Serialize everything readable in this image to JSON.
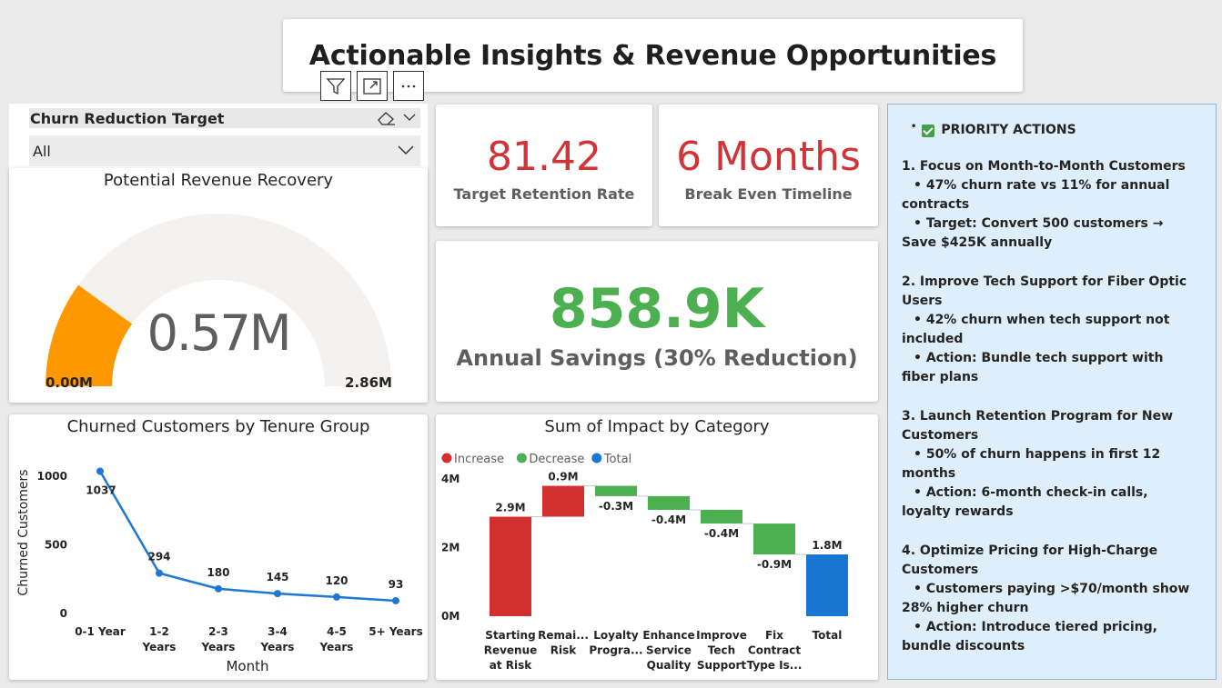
{
  "page": {
    "title": "Actionable Insights & Revenue Opportunities"
  },
  "visual_header": {
    "icons": [
      "filter-icon",
      "focus-mode-icon",
      "more-options-icon"
    ]
  },
  "slicer": {
    "title": "Churn Reduction Target",
    "value": "All"
  },
  "gauge": {
    "title": "Potential Revenue Recovery",
    "value_label": "0.57M",
    "min_label": "0.00M",
    "max_label": "2.86M",
    "value": 0.57,
    "min": 0,
    "max": 2.86,
    "fill_color": "#ff9800",
    "track_color": "#f3f2f1"
  },
  "kpis": {
    "retention": {
      "value": "81.42",
      "label": "Target Retention Rate"
    },
    "breakeven": {
      "value": "6 Months",
      "label": "Break Even Timeline"
    },
    "savings": {
      "value": "858.9K",
      "label": "Annual Savings (30% Reduction)"
    }
  },
  "colors": {
    "kpi_red": "#d13438",
    "kpi_green": "#4caf50",
    "line": "#1f77d4",
    "increase": "#d32f2f",
    "decrease": "#4caf50",
    "total": "#1976d2",
    "panel_bg": "#deeefb"
  },
  "chart_data": [
    {
      "type": "line",
      "title": "Churned Customers by Tenure Group",
      "xlabel": "Month",
      "ylabel": "Churned Customers",
      "categories": [
        "0-1 Year",
        "1-2 Years",
        "2-3 Years",
        "3-4 Years",
        "4-5 Years",
        "5+ Years"
      ],
      "series": [
        {
          "values": [
            1037,
            294,
            180,
            145,
            120,
            93
          ]
        }
      ],
      "ylim": [
        0,
        1100
      ],
      "yticks": [
        "0",
        "500",
        "1000"
      ],
      "grid": false
    },
    {
      "type": "bar",
      "subtype": "waterfall",
      "title": "Sum of Impact by Category",
      "legend": [
        "Increase",
        "Decrease",
        "Total"
      ],
      "legend_position": "top-left",
      "categories": [
        "Starting Revenue at Risk",
        "Remai... Risk",
        "Loyalty Progra...",
        "Enhance Service Quality",
        "Improve Tech Support",
        "Fix Contract Type Is...",
        "Total"
      ],
      "category_lines": [
        [
          "Starting",
          "Revenue",
          "at Risk"
        ],
        [
          "Remai...",
          "Risk"
        ],
        [
          "Loyalty",
          "Progra..."
        ],
        [
          "Enhance",
          "Service",
          "Quality"
        ],
        [
          "Improve",
          "Tech",
          "Support"
        ],
        [
          "Fix",
          "Contract",
          "Type Is..."
        ],
        [
          "Total"
        ]
      ],
      "values": [
        2.9,
        0.9,
        -0.3,
        -0.4,
        -0.4,
        -0.9,
        1.8
      ],
      "data_labels": [
        "2.9M",
        "0.9M",
        "-0.3M",
        "-0.4M",
        "-0.4M",
        "-0.9M",
        "1.8M"
      ],
      "kinds": [
        "increase",
        "increase",
        "decrease",
        "decrease",
        "decrease",
        "decrease",
        "total"
      ],
      "ylim": [
        0,
        4
      ],
      "yticks": [
        "0M",
        "2M",
        "4M"
      ],
      "grid": false
    }
  ],
  "actions": {
    "header": "PRIORITY ACTIONS",
    "blocks": [
      {
        "title": "1. Focus on Month-to-Month Customers",
        "bullets": [
          "• 47% churn rate vs 11% for annual contracts",
          "• Target: Convert 500 customers → Save $425K annually"
        ]
      },
      {
        "title": "2. Improve Tech Support for Fiber Optic Users",
        "bullets": [
          "• 42% churn when tech support not included",
          "• Action: Bundle tech support with fiber plans"
        ]
      },
      {
        "title": "3. Launch Retention Program for New Customers",
        "bullets": [
          "• 50% of churn happens in first 12 months",
          "• Action: 6-month check-in calls, loyalty rewards"
        ]
      },
      {
        "title": "4. Optimize Pricing for High-Charge Customers",
        "bullets": [
          "• Customers paying >$70/month show 28% higher churn",
          "• Action: Introduce tiered pricing, bundle discounts"
        ]
      }
    ]
  }
}
